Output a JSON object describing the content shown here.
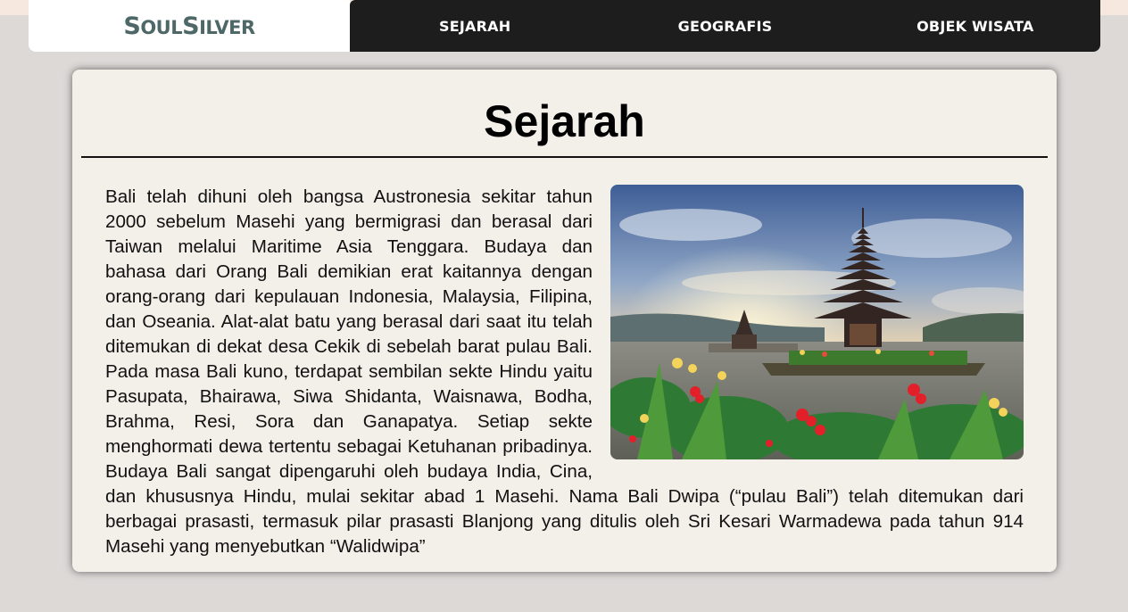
{
  "brand": {
    "first_big": "S",
    "first_small": "OUL",
    "second_big": "S",
    "second_small": "ILVER"
  },
  "nav": {
    "items": [
      {
        "label": "SEJARAH"
      },
      {
        "label": "GEOGRAFIS"
      },
      {
        "label": "OBJEK WISATA"
      }
    ]
  },
  "section": {
    "title": "Sejarah",
    "body": "Bali telah dihuni oleh bangsa Austronesia sekitar tahun 2000 sebelum Masehi yang bermigrasi dan berasal dari Taiwan melalui Maritime Asia Tenggara. Budaya dan bahasa dari Orang Bali demikian erat kaitannya dengan orang-orang dari kepulauan Indonesia, Malaysia, Filipina, dan Oseania. Alat-alat batu yang berasal dari saat itu telah ditemukan di dekat desa Cekik di sebelah barat pulau Bali. Pada masa Bali kuno, terdapat sembilan sekte Hindu yaitu Pasupata, Bhairawa, Siwa Shidanta, Waisnawa, Bodha, Brahma, Resi, Sora dan Ganapatya. Setiap sekte menghormati dewa tertentu sebagai Ketuhanan pribadinya. Budaya Bali sangat dipengaruhi oleh budaya India, Cina, dan khususnya Hindu, mulai sekitar abad 1 Masehi. Nama Bali Dwipa (“pulau Bali”) telah ditemukan dari berbagai prasasti, termasuk pilar prasasti Blanjong yang ditulis oleh Sri Kesari Warmadewa pada tahun 914 Masehi yang menyebutkan “Walidwipa”"
  },
  "colors": {
    "nav_bg": "#1d1d1d",
    "brand_text": "#4e6868",
    "card_bg": "#f3efe9",
    "page_bg": "#dcd9d7"
  }
}
